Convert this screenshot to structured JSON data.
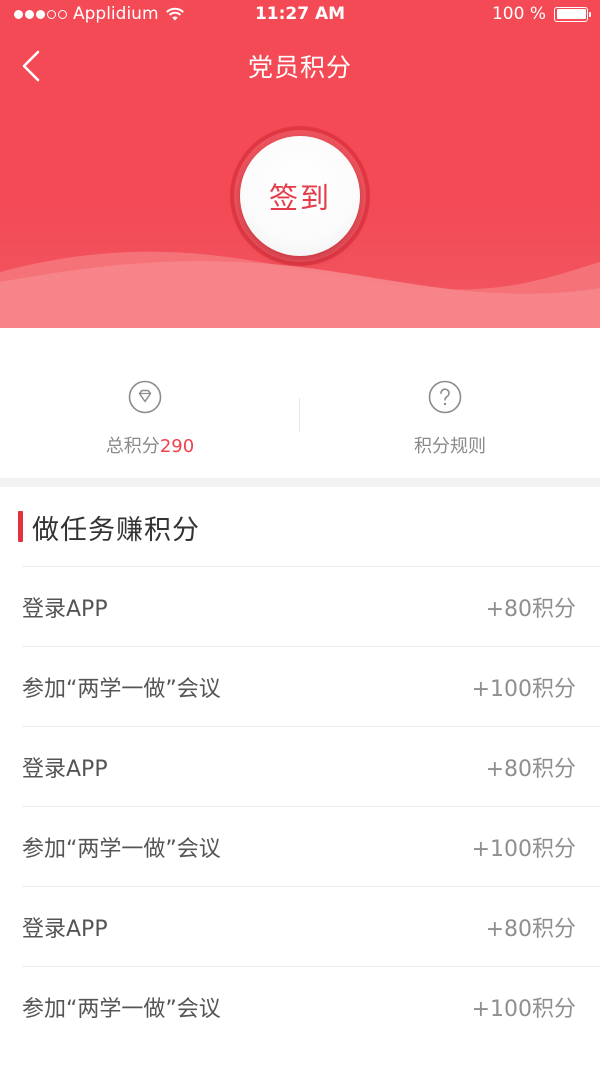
{
  "status_bar": {
    "carrier": "Applidium",
    "time": "11:27 AM",
    "battery": "100 %"
  },
  "nav": {
    "title": "党员积分"
  },
  "checkin": {
    "label": "签到"
  },
  "stats": {
    "total_label": "总积分",
    "total_value": "290",
    "rules_label": "积分规则"
  },
  "tasks": {
    "section_title": "做任务赚积分",
    "items": [
      {
        "name": "登录APP",
        "points": "+80积分"
      },
      {
        "name": "参加“两学一做”会议",
        "points": "+100积分"
      },
      {
        "name": "登录APP",
        "points": "+80积分"
      },
      {
        "name": "参加“两学一做”会议",
        "points": "+100积分"
      },
      {
        "name": "登录APP",
        "points": "+80积分"
      },
      {
        "name": "参加“两学一做”会议",
        "points": "+100积分"
      }
    ]
  },
  "colors": {
    "brand_red": "#f44a55",
    "accent_red": "#e2323e",
    "points_text": "#8f8f8f"
  }
}
